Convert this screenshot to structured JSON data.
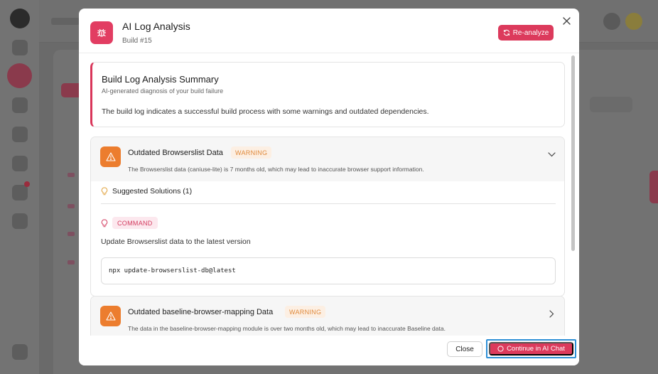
{
  "modal": {
    "title": "AI Log Analysis",
    "subtitle": "Build #15",
    "reanalyze_label": "Re-analyze"
  },
  "summary": {
    "title": "Build Log Analysis Summary",
    "subtitle": "AI-generated diagnosis of your build failure",
    "text": "The build log indicates a successful build process with some warnings and outdated dependencies."
  },
  "issues": [
    {
      "title": "Outdated Browserslist Data",
      "badge": "WARNING",
      "description": "The Browserslist data (caniuse-lite) is 7 months old, which may lead to inaccurate browser support information.",
      "expanded": true,
      "solutions_heading": "Suggested Solutions (1)",
      "solution_type": "COMMAND",
      "solution_text": "Update Browserslist data to the latest version",
      "solution_code": "npx update-browserslist-db@latest"
    },
    {
      "title": "Outdated baseline-browser-mapping Data",
      "badge": "WARNING",
      "description": "The data in the baseline-browser-mapping module is over two months old, which may lead to inaccurate Baseline data.",
      "expanded": false
    }
  ],
  "footer": {
    "close_label": "Close",
    "continue_label": "Continue in AI Chat"
  },
  "colors": {
    "accent": "#dc3a5c",
    "warning": "#ec7d2e",
    "focus_ring": "#2d8fd6"
  }
}
